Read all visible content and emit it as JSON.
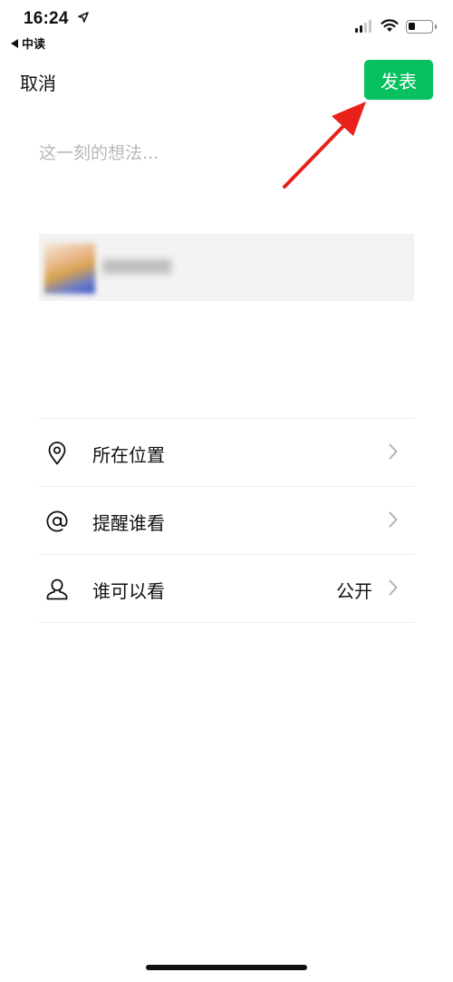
{
  "status_bar": {
    "time": "16:24",
    "back_app": "中读",
    "battery_level": 0.3
  },
  "nav": {
    "cancel_label": "取消",
    "publish_label": "发表"
  },
  "composer": {
    "placeholder": "这一刻的想法..."
  },
  "options": [
    {
      "label": "所在位置",
      "value": "",
      "icon": "location-pin-icon"
    },
    {
      "label": "提醒谁看",
      "value": "",
      "icon": "at-sign-icon"
    },
    {
      "label": "谁可以看",
      "value": "公开",
      "icon": "person-icon"
    }
  ],
  "colors": {
    "accent": "#07c160",
    "annotation": "#e8211b",
    "placeholder": "#b8b8b8"
  }
}
